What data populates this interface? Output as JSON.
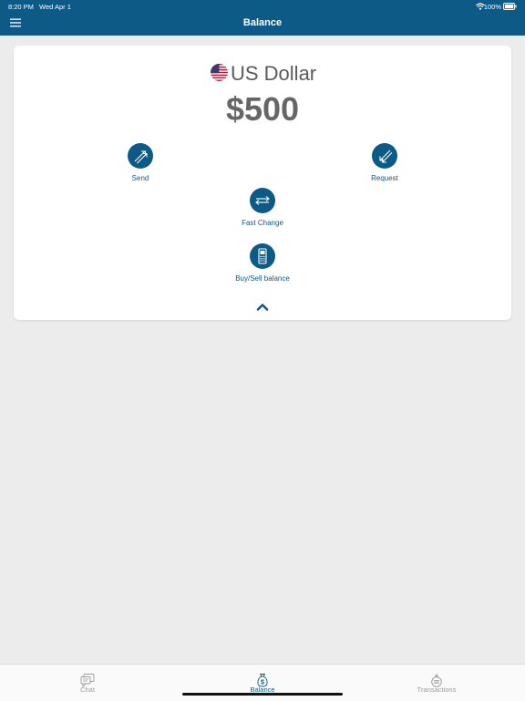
{
  "status": {
    "time": "8:20 PM",
    "date": "Wed Apr 1",
    "battery": "100%"
  },
  "header": {
    "title": "Balance"
  },
  "balance": {
    "currency": "US Dollar",
    "amount": "$500"
  },
  "actions": {
    "send": "Send",
    "request": "Request",
    "fast_change": "Fast Change",
    "buy_sell": "Buy/Sell balance"
  },
  "tabs": [
    {
      "label": "Chat",
      "icon": "chat-icon",
      "active": false
    },
    {
      "label": "Balance",
      "icon": "money-bag-icon",
      "active": true
    },
    {
      "label": "Transactions",
      "icon": "transactions-icon",
      "active": false
    }
  ],
  "colors": {
    "primary": "#0e5a87",
    "background": "#ececec",
    "inactive_tab": "#9a9a9a"
  }
}
